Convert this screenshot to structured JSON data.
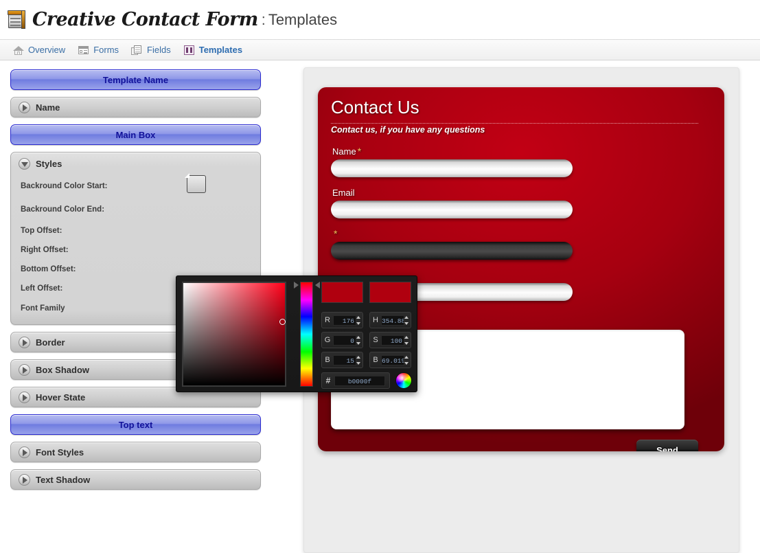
{
  "header": {
    "logo_icon": "contact-form-box-icon",
    "title": "Creative Contact Form",
    "separator": ":",
    "subtitle": "Templates"
  },
  "nav": {
    "tabs": [
      {
        "label": "Overview",
        "icon": "home-icon",
        "active": false
      },
      {
        "label": "Forms",
        "icon": "forms-icon",
        "active": false
      },
      {
        "label": "Fields",
        "icon": "fields-icon",
        "active": false
      },
      {
        "label": "Templates",
        "icon": "templates-icon",
        "active": true
      }
    ]
  },
  "sidebar": {
    "sections": [
      {
        "kind": "title",
        "label": "Template Name"
      },
      {
        "kind": "accordion",
        "label": "Name",
        "open": false,
        "icon": "chevron-right-icon"
      },
      {
        "kind": "title",
        "label": "Main Box"
      },
      {
        "kind": "accordion",
        "label": "Styles",
        "open": true,
        "icon": "chevron-down-icon"
      },
      {
        "kind": "accordion",
        "label": "Border",
        "open": false,
        "icon": "chevron-right-icon"
      },
      {
        "kind": "accordion",
        "label": "Box Shadow",
        "open": false,
        "icon": "chevron-right-icon"
      },
      {
        "kind": "accordion",
        "label": "Hover State",
        "open": false,
        "icon": "chevron-right-icon"
      },
      {
        "kind": "title",
        "label": "Top text"
      },
      {
        "kind": "accordion",
        "label": "Font Styles",
        "open": false,
        "icon": "chevron-right-icon"
      },
      {
        "kind": "accordion",
        "label": "Text Shadow",
        "open": false,
        "icon": "chevron-right-icon"
      }
    ],
    "styles_fields": {
      "bg_color_start": "Backround Color Start:",
      "bg_color_end": "Backround Color End:",
      "top_offset": "Top Offset:",
      "right_offset": "Right Offset:",
      "bottom_offset": "Bottom Offset:",
      "left_offset": "Left Offset:",
      "font_family": "Font Family",
      "swatch_color": "#b0000f"
    }
  },
  "color_picker": {
    "sv_gradient_hue": "#ff0019",
    "preview_new": "#b0000f",
    "preview_old": "#b0000f",
    "fields": [
      {
        "label": "R",
        "value": "176"
      },
      {
        "label": "G",
        "value": "0"
      },
      {
        "label": "B",
        "value": "15"
      },
      {
        "label": "H",
        "value": "354.88"
      },
      {
        "label": "S",
        "value": "100"
      },
      {
        "label": "B",
        "value": "69.019"
      }
    ],
    "hex_label": "#",
    "hex_value": "b0000f",
    "wheel_icon": "color-wheel-icon"
  },
  "preview": {
    "form": {
      "title": "Contact Us",
      "subtitle": "Contact us, if you have any questions",
      "accent_color": "#b0000f",
      "fields": [
        {
          "label": "Name",
          "required": true,
          "required_mark": "*",
          "state": "normal"
        },
        {
          "label": "Email",
          "required": false,
          "required_mark": "",
          "state": "normal"
        },
        {
          "label": "",
          "required": true,
          "required_mark": "*",
          "state": "focused"
        },
        {
          "label": "",
          "required": false,
          "required_mark": "",
          "state": "normal"
        }
      ],
      "message_placeholder": "",
      "send_label": "Send"
    }
  }
}
